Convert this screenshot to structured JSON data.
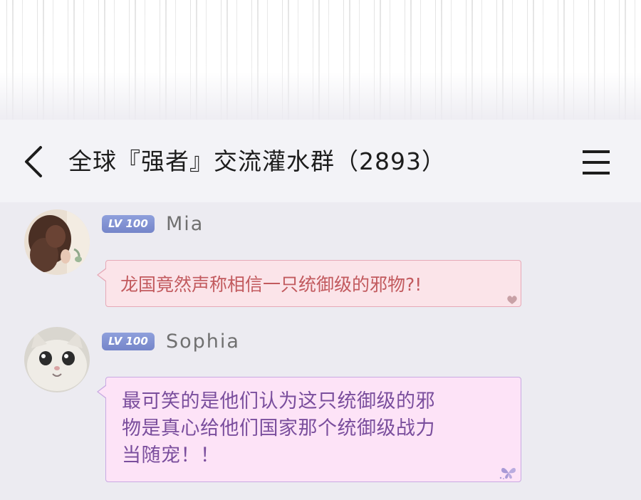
{
  "header": {
    "title": "全球『强者』交流灌水群（2893）",
    "back_icon": "chevron-left-icon",
    "menu_icon": "hamburger-menu-icon"
  },
  "messages": [
    {
      "badge": "LV 100",
      "username": "Mia",
      "avatar_icon": "user-avatar-girl",
      "lines": [
        "龙国竟然声称相信一只统御级的邪物?!"
      ],
      "bubble_style": "pink",
      "decoration_icon": "heart-icon",
      "colors": {
        "bubble_bg": "#fbe4e9",
        "bubble_border": "#e6a9b7",
        "text": "#c25a5e"
      }
    },
    {
      "badge": "LV 100",
      "username": "Sophia",
      "avatar_icon": "user-avatar-cat",
      "lines": [
        "最可笑的是他们认为这只统御级的邪",
        "物是真心给他们国家那个统御级战力",
        "当随宠！！"
      ],
      "bubble_style": "purple",
      "decoration_icon": "butterfly-icon",
      "colors": {
        "bubble_bg": "#fde3f7",
        "bubble_border": "#c9a9e2",
        "text": "#7a4e9d"
      }
    }
  ],
  "colors": {
    "badge_bg": "#7f8fd2",
    "chat_bg": "#ecebf1",
    "header_bg": "#f3f3f7"
  }
}
